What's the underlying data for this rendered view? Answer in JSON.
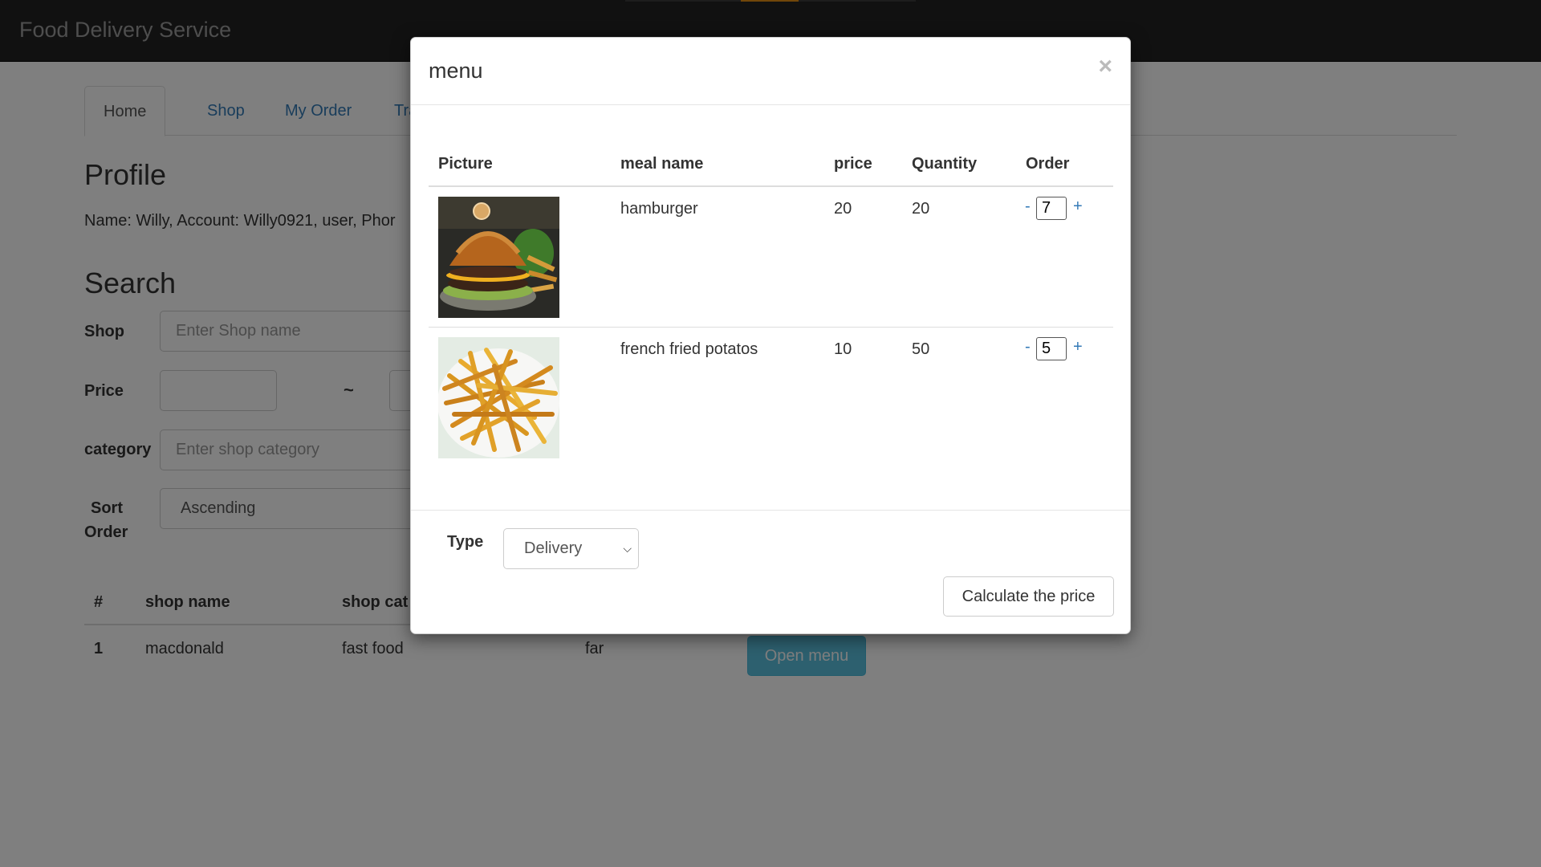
{
  "navbar": {
    "brand": "Food Delivery Service"
  },
  "tabs": [
    {
      "label": "Home"
    },
    {
      "label": "Shop"
    },
    {
      "label": "My Order"
    },
    {
      "label": "Tran"
    }
  ],
  "profile": {
    "title": "Profile",
    "line": "Name: Willy, Account: Willy0921, user, Phor"
  },
  "search": {
    "title": "Search",
    "shop_label": "Shop",
    "shop_placeholder": "Enter Shop name",
    "price_label": "Price",
    "price_sep": "~",
    "category_label": "category",
    "category_placeholder": "Enter shop category",
    "sort_label_1": "Sort",
    "sort_label_2": "Order",
    "sort_value": "Ascending"
  },
  "shop_table": {
    "headers": [
      "#",
      "shop name",
      "shop cat"
    ],
    "row": {
      "index": "1",
      "name": "macdonald",
      "category": "fast food",
      "distance": "far",
      "button": "Open menu"
    }
  },
  "modal": {
    "title": "menu",
    "close": "×",
    "headers": [
      "Picture",
      "meal name",
      "price",
      "Quantity",
      "Order"
    ],
    "items": [
      {
        "name": "hamburger",
        "price": "20",
        "quantity": "20",
        "order": "7",
        "image_icon": "hamburger-photo"
      },
      {
        "name": "french fried potatos",
        "price": "10",
        "quantity": "50",
        "order": "5",
        "image_icon": "fries-photo"
      }
    ],
    "minus": "-",
    "plus": "+",
    "type_label": "Type",
    "type_value": "Delivery",
    "calc_button": "Calculate the price"
  },
  "colors": {
    "navbar": "#222222",
    "accent": "#e38d13",
    "link": "#337ab7",
    "info_button": "#5bc0de"
  }
}
